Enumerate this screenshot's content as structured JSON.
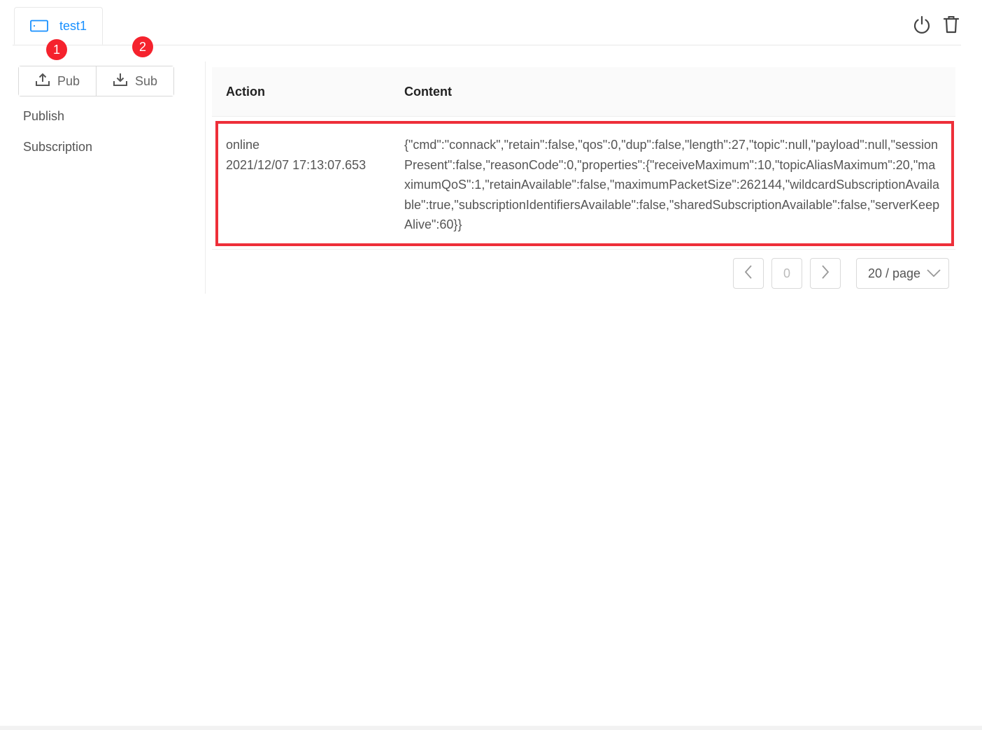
{
  "tabs": [
    {
      "label": "test1",
      "icon": "connection-icon",
      "active": true
    }
  ],
  "top_actions": {
    "disconnect_icon": "power-icon",
    "delete_icon": "trash-icon"
  },
  "badges": {
    "one": "1",
    "two": "2"
  },
  "left_panel": {
    "pub_label": "Pub",
    "sub_label": "Sub",
    "menu": [
      {
        "label": "Publish"
      },
      {
        "label": "Subscription"
      }
    ]
  },
  "table": {
    "columns": [
      "Action",
      "Content"
    ],
    "rows": [
      {
        "action": "online",
        "time": "2021/12/07 17:13:07.653",
        "content": "{\"cmd\":\"connack\",\"retain\":false,\"qos\":0,\"dup\":false,\"length\":27,\"topic\":null,\"payload\":null,\"sessionPresent\":false,\"reasonCode\":0,\"properties\":{\"receiveMaximum\":10,\"topicAliasMaximum\":20,\"maximumQoS\":1,\"retainAvailable\":false,\"maximumPacketSize\":262144,\"wildcardSubscriptionAvailable\":true,\"subscriptionIdentifiersAvailable\":false,\"sharedSubscriptionAvailable\":false,\"serverKeepAlive\":60}}"
      }
    ]
  },
  "pagination": {
    "current": "0",
    "page_size": "20 / page"
  },
  "colors": {
    "accent": "#1890ff",
    "highlight": "#ee2f39",
    "badge": "#f5222d"
  }
}
